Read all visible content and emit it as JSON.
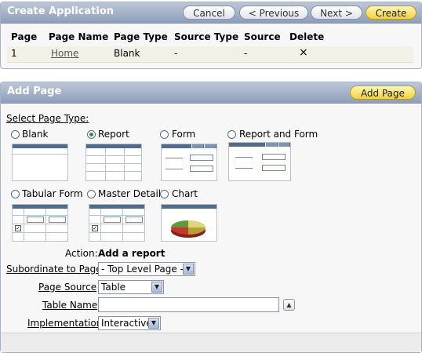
{
  "create_panel": {
    "title": "Create Application",
    "buttons": {
      "cancel": "Cancel",
      "previous": "< Previous",
      "next": "Next >",
      "create": "Create"
    },
    "columns": [
      "Page",
      "Page Name",
      "Page Type",
      "Source Type",
      "Source",
      "Delete"
    ],
    "rows": [
      {
        "page": "1",
        "page_name": "Home",
        "page_type": "Blank",
        "source_type": "-",
        "source": "-",
        "delete": "×"
      }
    ]
  },
  "add_panel": {
    "title": "Add Page",
    "add_button": "Add Page",
    "select_label": "Select Page Type:",
    "page_types": [
      {
        "label": "Blank",
        "selected": false
      },
      {
        "label": "Report",
        "selected": true
      },
      {
        "label": "Form",
        "selected": false
      },
      {
        "label": "Report and Form",
        "selected": false
      },
      {
        "label": "Tabular Form",
        "selected": false
      },
      {
        "label": "Master Detail",
        "selected": false
      },
      {
        "label": "Chart",
        "selected": false
      }
    ],
    "action_label": "Action:",
    "action_value": "Add a report",
    "subordinate_label": "Subordinate to Page",
    "subordinate_value": "- Top Level Page -",
    "page_source_label": "Page Source",
    "page_source_value": "Table",
    "table_name_label": "Table Name",
    "table_name_value": "",
    "implementation_label": "Implementation",
    "implementation_value": "Interactive"
  },
  "colors": {
    "header_gradient_top": "#bcc7d7",
    "header_gradient_bottom": "#8e9fbb",
    "accent_yellow": "#f3d33b",
    "selected_radio": "#2e8b2e"
  }
}
